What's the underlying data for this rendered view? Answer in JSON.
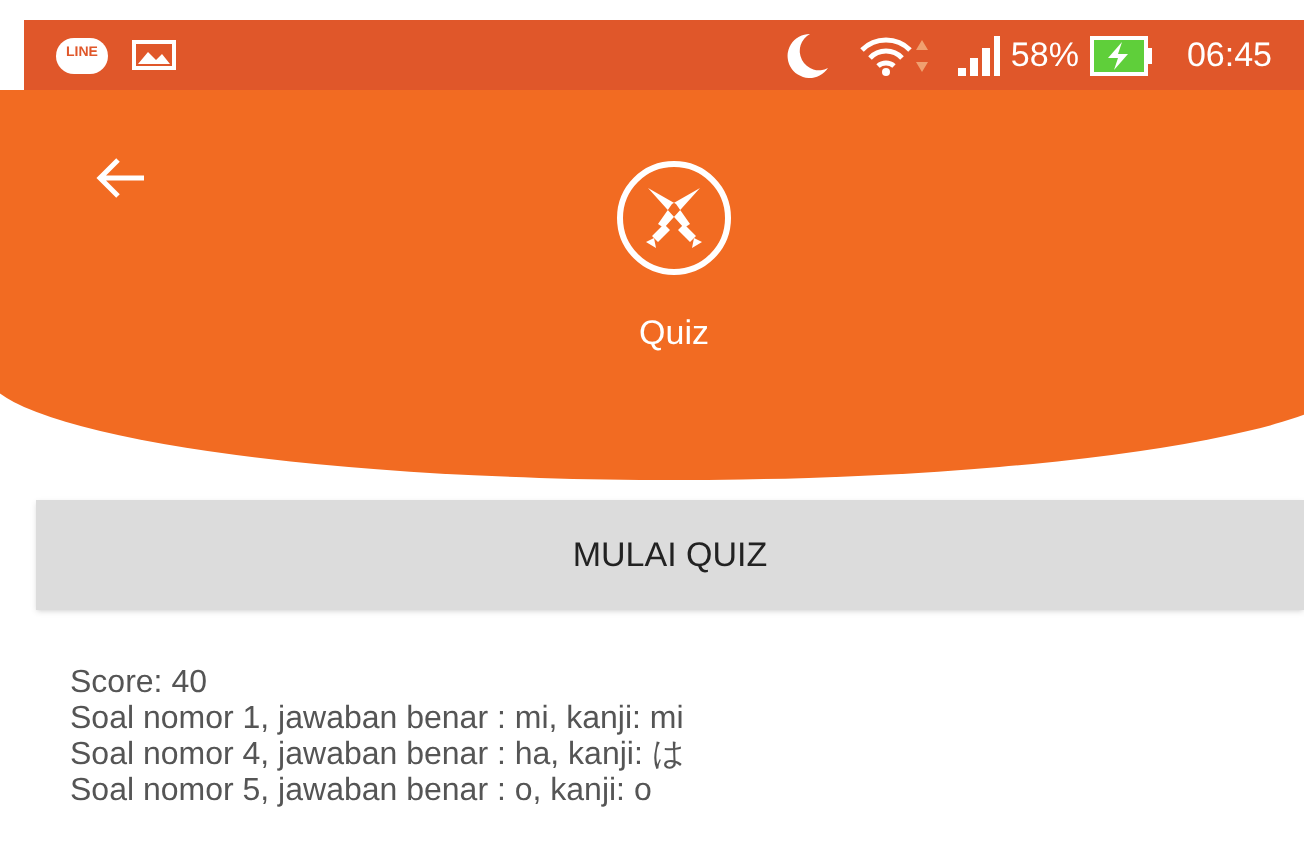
{
  "status_bar": {
    "notification_app": "LINE",
    "battery_percent": "58%",
    "time": "06:45"
  },
  "header": {
    "title": "Quiz"
  },
  "start_button": {
    "label": "MULAI QUIZ"
  },
  "results": {
    "score": "Score: 40",
    "answers": [
      "Soal nomor 1, jawaban benar : mi, kanji: mi",
      "Soal nomor 4, jawaban benar : ha, kanji: は",
      "Soal nomor 5, jawaban benar : o, kanji: o"
    ]
  }
}
